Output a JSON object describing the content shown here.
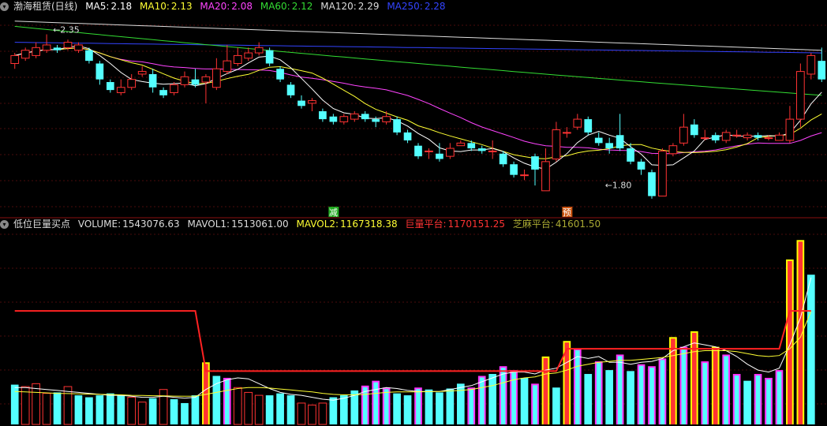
{
  "top_legend": {
    "title": "渤海租赁(日线)",
    "items": [
      {
        "label": "MA5:",
        "value": "2.18",
        "color": "#ffffff"
      },
      {
        "label": "MA10:",
        "value": "2.13",
        "color": "#ffff33"
      },
      {
        "label": "MA20:",
        "value": "2.08",
        "color": "#ff44ff"
      },
      {
        "label": "MA60:",
        "value": "2.12",
        "color": "#33dd33"
      },
      {
        "label": "MA120:",
        "value": "2.29",
        "color": "#dddddd"
      },
      {
        "label": "MA250:",
        "value": "2.28",
        "color": "#3344ff"
      }
    ]
  },
  "bottom_legend": {
    "title": "低位巨量买点",
    "items": [
      {
        "label": "VOLUME:",
        "value": "1543076.63",
        "color": "#dddddd"
      },
      {
        "label": "MAVOL1:",
        "value": "1513061.00",
        "color": "#dddddd"
      },
      {
        "label": "MAVOL2:",
        "value": "1167318.38",
        "color": "#ffff33"
      },
      {
        "label": "巨量平台:",
        "value": "1170151.25",
        "color": "#ff3333"
      },
      {
        "label": "芝麻平台:",
        "value": "41601.50",
        "color": "#aaaa33"
      }
    ]
  },
  "chart_data": [
    {
      "type": "candlestick",
      "price_range": [
        1.7,
        2.42
      ],
      "colors": {
        "up": "#ff3333",
        "down": "#54ffff",
        "ma5": "#ffffff",
        "ma10": "#ffff33",
        "ma20": "#ff44ff",
        "ma60": "#33dd33",
        "ma120": "#dddddd",
        "ma250": "#3344ff"
      },
      "annotations": [
        {
          "text": "2.35",
          "index": 3,
          "price": 2.35
        },
        {
          "text": "1.80",
          "index": 55,
          "price": 1.8
        }
      ],
      "markers": [
        {
          "text": "减",
          "index": 30,
          "bg": "#22aa22"
        },
        {
          "text": "预",
          "index": 52,
          "bg": "#cc5511"
        }
      ],
      "candles": [
        [
          2.24,
          2.27,
          2.28,
          2.22
        ],
        [
          2.26,
          2.29,
          2.3,
          2.25
        ],
        [
          2.27,
          2.3,
          2.32,
          2.26
        ],
        [
          2.29,
          2.31,
          2.35,
          2.28
        ],
        [
          2.3,
          2.29,
          2.31,
          2.28
        ],
        [
          2.3,
          2.32,
          2.33,
          2.29
        ],
        [
          2.29,
          2.31,
          2.32,
          2.28
        ],
        [
          2.29,
          2.25,
          2.3,
          2.24
        ],
        [
          2.24,
          2.18,
          2.25,
          2.16
        ],
        [
          2.17,
          2.14,
          2.18,
          2.13
        ],
        [
          2.13,
          2.15,
          2.18,
          2.12
        ],
        [
          2.15,
          2.18,
          2.2,
          2.14
        ],
        [
          2.2,
          2.21,
          2.23,
          2.19
        ],
        [
          2.2,
          2.15,
          2.22,
          2.13
        ],
        [
          2.14,
          2.12,
          2.15,
          2.11
        ],
        [
          2.13,
          2.16,
          2.17,
          2.12
        ],
        [
          2.16,
          2.19,
          2.21,
          2.15
        ],
        [
          2.18,
          2.16,
          2.22,
          2.15
        ],
        [
          2.17,
          2.19,
          2.2,
          2.09
        ],
        [
          2.15,
          2.22,
          2.26,
          2.14
        ],
        [
          2.21,
          2.25,
          2.31,
          2.2
        ],
        [
          2.24,
          2.27,
          2.3,
          2.23
        ],
        [
          2.26,
          2.28,
          2.3,
          2.25
        ],
        [
          2.28,
          2.3,
          2.32,
          2.27
        ],
        [
          2.29,
          2.24,
          2.3,
          2.23
        ],
        [
          2.22,
          2.18,
          2.23,
          2.17
        ],
        [
          2.16,
          2.12,
          2.17,
          2.11
        ],
        [
          2.1,
          2.08,
          2.12,
          2.07
        ],
        [
          2.09,
          2.1,
          2.11,
          2.06
        ],
        [
          2.06,
          2.03,
          2.07,
          2.02
        ],
        [
          2.04,
          2.02,
          2.05,
          2.01
        ],
        [
          2.02,
          2.04,
          2.05,
          2.01
        ],
        [
          2.03,
          2.05,
          2.06,
          2.02
        ],
        [
          2.05,
          2.03,
          2.06,
          2.02
        ],
        [
          2.03,
          2.02,
          2.04,
          2.0
        ],
        [
          2.02,
          2.04,
          2.06,
          2.01
        ],
        [
          2.03,
          1.98,
          2.04,
          1.97
        ],
        [
          1.98,
          1.95,
          1.99,
          1.94
        ],
        [
          1.93,
          1.89,
          1.94,
          1.88
        ],
        [
          1.91,
          1.91,
          1.92,
          1.88
        ],
        [
          1.9,
          1.88,
          1.94,
          1.87
        ],
        [
          1.89,
          1.92,
          1.94,
          1.88
        ],
        [
          1.93,
          1.94,
          1.95,
          1.93
        ],
        [
          1.94,
          1.92,
          1.95,
          1.91
        ],
        [
          1.92,
          1.91,
          1.93,
          1.9
        ],
        [
          1.91,
          1.91,
          1.95,
          1.88
        ],
        [
          1.9,
          1.86,
          1.91,
          1.85
        ],
        [
          1.86,
          1.82,
          1.87,
          1.81
        ],
        [
          1.82,
          1.82,
          1.84,
          1.8
        ],
        [
          1.89,
          1.84,
          1.9,
          1.78
        ],
        [
          1.76,
          1.87,
          1.92,
          1.77
        ],
        [
          1.88,
          1.99,
          2.02,
          1.87
        ],
        [
          1.98,
          1.98,
          2.0,
          1.96
        ],
        [
          2.0,
          2.03,
          2.05,
          1.99
        ],
        [
          2.03,
          1.98,
          2.04,
          1.97
        ],
        [
          1.96,
          1.94,
          1.98,
          1.93
        ],
        [
          1.94,
          1.92,
          1.96,
          1.9
        ],
        [
          1.97,
          1.92,
          2.05,
          1.91
        ],
        [
          1.92,
          1.87,
          1.94,
          1.86
        ],
        [
          1.87,
          1.84,
          1.88,
          1.82
        ],
        [
          1.83,
          1.74,
          1.84,
          1.73
        ],
        [
          1.74,
          1.91,
          1.92,
          1.74
        ],
        [
          1.9,
          1.93,
          1.94,
          1.89
        ],
        [
          1.94,
          2.0,
          2.05,
          1.93
        ],
        [
          2.01,
          1.97,
          2.03,
          1.96
        ],
        [
          1.96,
          1.96,
          1.99,
          1.95
        ],
        [
          1.97,
          1.95,
          1.98,
          1.94
        ],
        [
          1.95,
          1.98,
          1.99,
          1.94
        ],
        [
          1.97,
          1.97,
          1.99,
          1.96
        ],
        [
          1.96,
          1.97,
          1.98,
          1.95
        ],
        [
          1.97,
          1.96,
          1.98,
          1.95
        ],
        [
          1.96,
          1.96,
          1.97,
          1.95
        ],
        [
          1.95,
          1.97,
          1.98,
          1.95
        ],
        [
          1.95,
          2.03,
          2.08,
          1.94
        ],
        [
          2.03,
          2.21,
          2.24,
          2.0
        ],
        [
          2.2,
          2.27,
          2.28,
          2.18
        ],
        [
          2.25,
          2.18,
          2.3,
          2.17
        ]
      ]
    },
    {
      "type": "bar",
      "value_max": 2000000,
      "colors": {
        "up": "#ff3333",
        "down": "#54ffff",
        "mark_yellow": "#ffff00",
        "mark_magenta": "#ff33ff",
        "mavol1": "#ffffff",
        "mavol2": "#ffff33",
        "platform": "#ff2222"
      },
      "volumes": [
        [
          410000,
          "down"
        ],
        [
          390000,
          "up"
        ],
        [
          420000,
          "up"
        ],
        [
          320000,
          "up"
        ],
        [
          330000,
          "down"
        ],
        [
          390000,
          "up"
        ],
        [
          300000,
          "down"
        ],
        [
          280000,
          "down"
        ],
        [
          300000,
          "down"
        ],
        [
          320000,
          "down"
        ],
        [
          300000,
          "down"
        ],
        [
          280000,
          "up"
        ],
        [
          230000,
          "up"
        ],
        [
          270000,
          "down"
        ],
        [
          360000,
          "up"
        ],
        [
          260000,
          "down"
        ],
        [
          220000,
          "down"
        ],
        [
          300000,
          "down"
        ],
        [
          640000,
          "yellow"
        ],
        [
          500000,
          "down"
        ],
        [
          480000,
          "magenta"
        ],
        [
          380000,
          "up"
        ],
        [
          330000,
          "up"
        ],
        [
          300000,
          "up"
        ],
        [
          300000,
          "down"
        ],
        [
          320000,
          "down"
        ],
        [
          300000,
          "down"
        ],
        [
          220000,
          "up"
        ],
        [
          200000,
          "up"
        ],
        [
          220000,
          "up"
        ],
        [
          280000,
          "down"
        ],
        [
          300000,
          "down"
        ],
        [
          350000,
          "down"
        ],
        [
          400000,
          "magenta"
        ],
        [
          450000,
          "magenta"
        ],
        [
          380000,
          "magenta"
        ],
        [
          320000,
          "down"
        ],
        [
          300000,
          "down"
        ],
        [
          380000,
          "magenta"
        ],
        [
          360000,
          "down"
        ],
        [
          330000,
          "down"
        ],
        [
          370000,
          "down"
        ],
        [
          420000,
          "down"
        ],
        [
          380000,
          "magenta"
        ],
        [
          500000,
          "magenta"
        ],
        [
          520000,
          "down"
        ],
        [
          600000,
          "magenta"
        ],
        [
          560000,
          "magenta"
        ],
        [
          480000,
          "down"
        ],
        [
          420000,
          "magenta"
        ],
        [
          700000,
          "yellow"
        ],
        [
          380000,
          "down"
        ],
        [
          860000,
          "yellow"
        ],
        [
          780000,
          "magenta"
        ],
        [
          520000,
          "down"
        ],
        [
          650000,
          "magenta"
        ],
        [
          560000,
          "down"
        ],
        [
          720000,
          "magenta"
        ],
        [
          550000,
          "down"
        ],
        [
          620000,
          "magenta"
        ],
        [
          600000,
          "magenta"
        ],
        [
          680000,
          "magenta"
        ],
        [
          900000,
          "yellow"
        ],
        [
          800000,
          "magenta"
        ],
        [
          960000,
          "yellow"
        ],
        [
          650000,
          "magenta"
        ],
        [
          800000,
          "yellow"
        ],
        [
          720000,
          "magenta"
        ],
        [
          520000,
          "magenta"
        ],
        [
          450000,
          "down"
        ],
        [
          520000,
          "magenta"
        ],
        [
          480000,
          "magenta"
        ],
        [
          560000,
          "magenta"
        ],
        [
          1700000,
          "yellow"
        ],
        [
          1900000,
          "yellow"
        ],
        [
          1543076,
          "down"
        ]
      ],
      "mavol1": [
        380000,
        380000,
        370000,
        360000,
        350000,
        340000,
        330000,
        320000,
        310000,
        300000,
        300000,
        290000,
        280000,
        280000,
        290000,
        280000,
        270000,
        280000,
        360000,
        420000,
        460000,
        480000,
        470000,
        420000,
        370000,
        330000,
        310000,
        300000,
        280000,
        260000,
        250000,
        270000,
        300000,
        340000,
        360000,
        380000,
        370000,
        350000,
        340000,
        340000,
        340000,
        360000,
        380000,
        400000,
        440000,
        480000,
        520000,
        540000,
        540000,
        520000,
        560000,
        580000,
        640000,
        700000,
        680000,
        700000,
        640000,
        640000,
        620000,
        640000,
        650000,
        680000,
        760000,
        800000,
        840000,
        820000,
        800000,
        760000,
        700000,
        620000,
        560000,
        540000,
        580000,
        820000,
        1100000,
        1513061
      ],
      "mavol2": [
        340000,
        335000,
        330000,
        325000,
        320000,
        318000,
        315000,
        312000,
        310000,
        308000,
        305000,
        300000,
        298000,
        296000,
        294000,
        292000,
        290000,
        292000,
        310000,
        330000,
        350000,
        370000,
        380000,
        380000,
        375000,
        365000,
        355000,
        345000,
        335000,
        320000,
        310000,
        305000,
        305000,
        310000,
        320000,
        330000,
        335000,
        335000,
        335000,
        338000,
        340000,
        345000,
        350000,
        360000,
        380000,
        400000,
        430000,
        460000,
        480000,
        490000,
        520000,
        530000,
        560000,
        600000,
        620000,
        640000,
        650000,
        660000,
        660000,
        670000,
        680000,
        690000,
        710000,
        730000,
        750000,
        760000,
        760000,
        760000,
        750000,
        730000,
        710000,
        700000,
        710000,
        780000,
        900000,
        1167318
      ],
      "platform_segments": [
        {
          "from": 0,
          "to": 17,
          "value": 1170000
        },
        {
          "from": 18,
          "to": 51,
          "value": 550000
        },
        {
          "from": 52,
          "to": 72,
          "value": 780000
        },
        {
          "from": 73,
          "to": 75,
          "value": 1170151
        }
      ]
    }
  ]
}
